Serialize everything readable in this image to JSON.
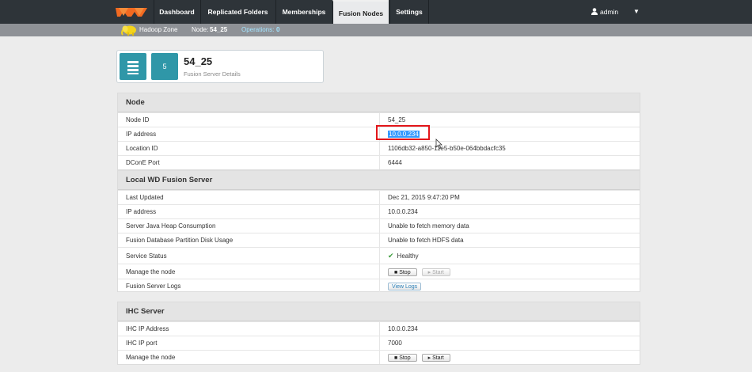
{
  "nav": {
    "tabs": [
      "Dashboard",
      "Replicated Folders",
      "Memberships",
      "Fusion Nodes",
      "Settings"
    ],
    "active": "Fusion Nodes",
    "user": "admin",
    "caret": "▼"
  },
  "subbar": {
    "zone": "Hadoop Zone",
    "node_label": "Node:",
    "node_value": "54_25",
    "ops_label": "Operations:",
    "ops_value": "0"
  },
  "header": {
    "badge": "5",
    "title": "54_25",
    "subtitle": "Fusion Server Details"
  },
  "node": {
    "title": "Node",
    "rows": [
      {
        "label": "Node ID",
        "value": "54_25"
      },
      {
        "label": "IP address",
        "value": "10.0.0.234"
      },
      {
        "label": "Location ID",
        "value": "1106db32-a850-11e5-b50e-064bbdacfc35"
      },
      {
        "label": "DConE Port",
        "value": "6444"
      }
    ]
  },
  "local": {
    "title": "Local WD Fusion Server",
    "rows": [
      {
        "label": "Last Updated",
        "value": "Dec 21, 2015 9:47:20 PM"
      },
      {
        "label": "IP address",
        "value": "10.0.0.234"
      },
      {
        "label": "Server Java Heap Consumption",
        "value": "Unable to fetch memory data"
      },
      {
        "label": "Fusion Database Partition Disk Usage",
        "value": "Unable to fetch HDFS data"
      },
      {
        "label": "Service Status",
        "value": "Healthy"
      },
      {
        "label": "Manage the node"
      },
      {
        "label": "Fusion Server Logs"
      }
    ],
    "stop": "Stop",
    "start": "Start",
    "view_logs": "View Logs"
  },
  "ihc": {
    "title": "IHC Server",
    "rows": [
      {
        "label": "IHC IP Address",
        "value": "10.0.0.234"
      },
      {
        "label": "IHC IP port",
        "value": "7000"
      },
      {
        "label": "Manage the node"
      }
    ],
    "stop": "Stop",
    "start": "Start"
  },
  "colors": {
    "nav_bg": "#2e3439",
    "accent": "#2f97a8",
    "highlight_box": "#e3161a",
    "healthy": "#3a9b3a"
  }
}
